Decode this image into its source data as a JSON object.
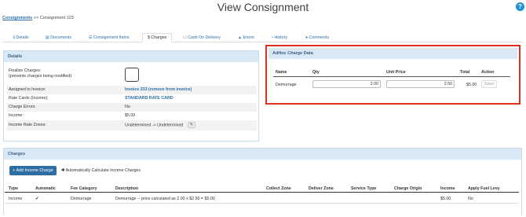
{
  "page": {
    "title": "View Consignment",
    "help_icon": "question-circle-icon",
    "help_glyph": "?"
  },
  "breadcrumb": {
    "parent": "Consignments",
    "separator": ">>",
    "current": "Consignment 123"
  },
  "tabs": [
    {
      "label": "Details",
      "icon": "info-icon",
      "glyph": "ℹ"
    },
    {
      "label": "Documents",
      "icon": "file-icon",
      "glyph": "▤"
    },
    {
      "label": "Consignment Items",
      "icon": "list-icon",
      "glyph": "☰"
    },
    {
      "label": "Charges",
      "icon": "dollar-icon",
      "glyph": "$"
    },
    {
      "label": "Cash On Delivery",
      "icon": "money-icon",
      "glyph": "▭"
    },
    {
      "label": "Errors",
      "icon": "warning-icon",
      "glyph": "▲"
    },
    {
      "label": "History",
      "icon": "clock-icon",
      "glyph": "◔"
    },
    {
      "label": "Comments",
      "icon": "comment-icon",
      "glyph": "●"
    }
  ],
  "details": {
    "title": "Details",
    "finalize_label_1": "Finalize Charges:",
    "finalize_label_2": "(prevents charges being modified)",
    "finalize_checked": false,
    "assigned_label": "Assigned to Invoice:",
    "invoice_link": "Invoice 233",
    "remove_link": "(remove from invoice)",
    "rate_card_label": "Rate Cards (Income):",
    "rate_card_value": "STANDARD RATE CARD",
    "charge_errors_label": "Charge Errors:",
    "charge_errors_value": "No",
    "income_label": "Income:",
    "income_value": "$5.00",
    "zones_label": "Income Rate Zones:",
    "zones_value": "Undetermined -> Undetermined",
    "edit_icon": "pencil-icon",
    "edit_glyph": "✎"
  },
  "adhoc": {
    "title": "AdHoc Charge Data",
    "headers": {
      "name": "Name",
      "qty": "Qty",
      "unit_price": "Unit Price",
      "total": "Total",
      "action": "Action"
    },
    "row": {
      "name": "Demurrage",
      "qty": "2.00",
      "unit_price": "2.50",
      "total": "$5.00",
      "save": "Save"
    }
  },
  "charges": {
    "title": "Charges",
    "add_button": "+ Add Income Charge",
    "auto_calc": "Automatically Calculate Income Charges",
    "auto_calc_icon": "calculator-icon",
    "auto_calc_glyph": "✱",
    "headers": {
      "type": "Type",
      "automatic": "Automatic",
      "fee_category": "Fee Category",
      "description": "Description",
      "collect_zone": "Collect Zone",
      "deliver_zone": "Deliver Zone",
      "service_type": "Service Type",
      "charge_origin": "Charge Origin",
      "income": "Income",
      "apply_fuel_levy": "Apply Fuel Levy"
    },
    "row": {
      "type": "Income",
      "automatic_icon": "check-icon",
      "automatic_glyph": "✔",
      "fee_category": "Demurrage",
      "description": "Demurrage -- price calculated as 2.00 x $2.50 = $5.00",
      "collect_zone": "",
      "deliver_zone": "",
      "service_type": "",
      "charge_origin": "",
      "income": "$5.00",
      "apply_fuel_levy": "No"
    }
  },
  "colors": {
    "accent": "#2a6fa8",
    "panel_header": "#d9e8f5",
    "highlight": "#e0301e",
    "primary_button": "#2e6da4"
  }
}
